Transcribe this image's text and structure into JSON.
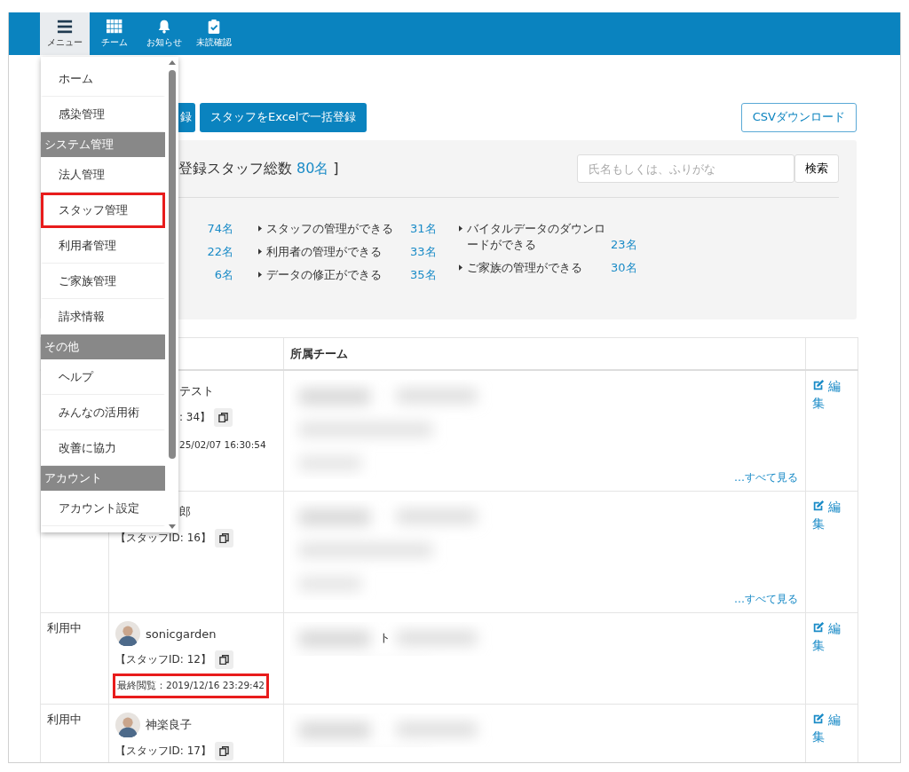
{
  "nav": [
    {
      "kind": "menu",
      "label": "メニュー",
      "selected": true
    },
    {
      "kind": "team",
      "label": "チーム",
      "selected": false
    },
    {
      "kind": "bell",
      "label": "お知らせ",
      "selected": false
    },
    {
      "kind": "check",
      "label": "未読確認",
      "selected": false
    }
  ],
  "menu": [
    {
      "kind": "item",
      "label": "ホーム",
      "highlighted": false
    },
    {
      "kind": "item",
      "label": "感染管理",
      "highlighted": false
    },
    {
      "kind": "header",
      "label": "システム管理"
    },
    {
      "kind": "item",
      "label": "法人管理",
      "highlighted": false
    },
    {
      "kind": "item",
      "label": "スタッフ管理",
      "highlighted": true
    },
    {
      "kind": "item",
      "label": "利用者管理",
      "highlighted": false
    },
    {
      "kind": "item",
      "label": "ご家族管理",
      "highlighted": false
    },
    {
      "kind": "item",
      "label": "請求情報",
      "highlighted": false
    },
    {
      "kind": "header",
      "label": "その他"
    },
    {
      "kind": "item",
      "label": "ヘルプ",
      "highlighted": false
    },
    {
      "kind": "item",
      "label": "みんなの活用術",
      "highlighted": false
    },
    {
      "kind": "item",
      "label": "改善に協力",
      "highlighted": false
    },
    {
      "kind": "header",
      "label": "アカウント"
    },
    {
      "kind": "item",
      "label": "アカウント設定",
      "highlighted": false
    }
  ],
  "buttons": [
    "録",
    "スタッフをExcelで一括登録"
  ],
  "csv_button": "CSVダウンロード",
  "summary": {
    "title": "登録スタッフ総数",
    "count": "80名",
    "close": "]",
    "search": {
      "placeholder": "氏名もしくは、ふりがな",
      "button": "検索"
    },
    "stats": [
      [
        {
          "value": "74名"
        },
        {
          "value": "22名"
        },
        {
          "value": "6名"
        }
      ],
      [
        {
          "label": "スタッフの管理ができる",
          "value": "31名"
        },
        {
          "label": "利用者の管理ができる",
          "value": "33名"
        },
        {
          "label": "データの修正ができる",
          "value": "35名"
        }
      ],
      [
        {
          "label": "バイタルデータのダウンロードができる",
          "value": "23名"
        },
        {
          "label": "ご家族の管理ができる",
          "value": "30名"
        }
      ]
    ]
  },
  "table": {
    "columns": [
      "所属チーム"
    ],
    "rows": [
      {
        "covered": true,
        "name": "テスト",
        "id": ": 34】",
        "last_viewed": "25/02/07 16:30:54",
        "last_highlighted": false,
        "see_all": "…すべて見る",
        "edit": "編集"
      },
      {
        "covered": true,
        "name": "郎",
        "id": "【スタッフID: 16】",
        "see_all": "…すべて見る",
        "edit": "編集"
      },
      {
        "covered": false,
        "status": "利用中",
        "name": "sonicgarden",
        "id": "【スタッフID: 12】",
        "last_viewed": "最終閲覧：2019/12/16 23:29:42",
        "last_highlighted": true,
        "team_text": "ト",
        "edit": "編集"
      },
      {
        "covered": false,
        "status": "利用中",
        "name": "神楽良子",
        "id": "【スタッフID: 17】",
        "edit": "編集"
      }
    ]
  }
}
